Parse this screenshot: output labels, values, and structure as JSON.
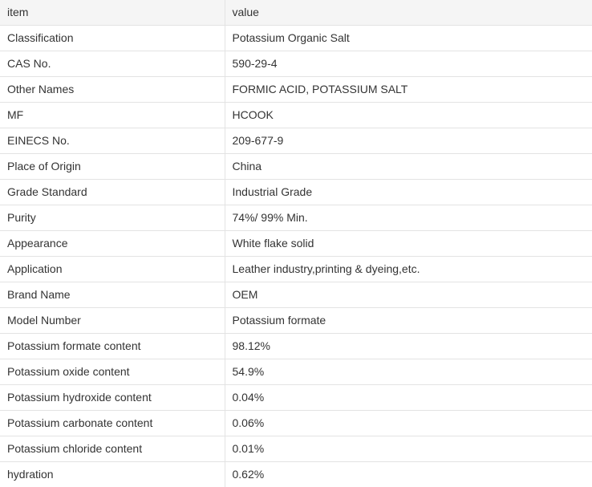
{
  "table": {
    "header": {
      "key": "item",
      "value": "value"
    },
    "rows": [
      {
        "key": "Classification",
        "value": "Potassium Organic Salt"
      },
      {
        "key": "CAS No.",
        "value": "590-29-4"
      },
      {
        "key": "Other Names",
        "value": "FORMIC ACID, POTASSIUM SALT"
      },
      {
        "key": "MF",
        "value": "HCOOK"
      },
      {
        "key": "EINECS No.",
        "value": "209-677-9"
      },
      {
        "key": "Place of Origin",
        "value": "China"
      },
      {
        "key": "Grade Standard",
        "value": "Industrial Grade"
      },
      {
        "key": "Purity",
        "value": "74%/ 99% Min."
      },
      {
        "key": "Appearance",
        "value": "White flake solid"
      },
      {
        "key": "Application",
        "value": "Leather industry,printing & dyeing,etc."
      },
      {
        "key": "Brand Name",
        "value": "OEM"
      },
      {
        "key": "Model Number",
        "value": "Potassium formate"
      },
      {
        "key": "Potassium formate content",
        "value": "98.12%"
      },
      {
        "key": "Potassium oxide content",
        "value": "54.9%"
      },
      {
        "key": "Potassium hydroxide content",
        "value": "0.04%"
      },
      {
        "key": "Potassium carbonate content",
        "value": "0.06%"
      },
      {
        "key": "Potassium chloride content",
        "value": "0.01%"
      },
      {
        "key": "hydration",
        "value": "0.62%"
      }
    ]
  }
}
